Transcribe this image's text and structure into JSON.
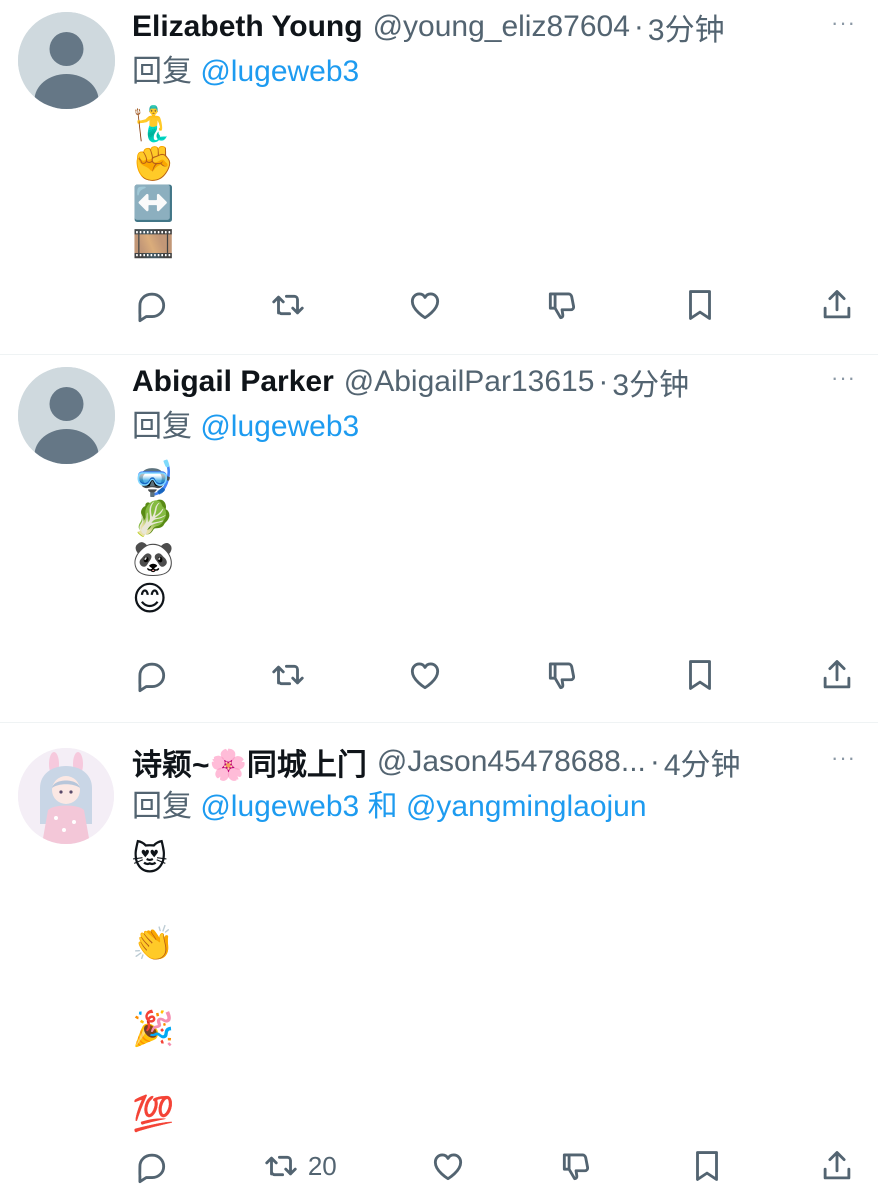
{
  "tweets": [
    {
      "name": "Elizabeth Young",
      "handle": "@young_eliz87604",
      "dot": "·",
      "time": "3分钟",
      "more": "···",
      "reply_prefix": "回复",
      "mentions": [
        "@lugeweb3"
      ],
      "emojis": [
        "🧜‍♂️",
        "✊",
        "↔️",
        "🎞️"
      ],
      "retweet_count": ""
    },
    {
      "name": "Abigail Parker",
      "handle": "@AbigailPar13615",
      "dot": "·",
      "time": "3分钟",
      "more": "···",
      "reply_prefix": "回复",
      "mentions": [
        "@lugeweb3"
      ],
      "emojis": [
        "🤿",
        "🥬",
        "🐼",
        "😊"
      ],
      "retweet_count": ""
    },
    {
      "name": "诗颖~🌸同城上门",
      "handle": "@Jason45478688...",
      "dot": "·",
      "time": "4分钟",
      "more": "···",
      "reply_prefix": "回复",
      "mentions": [
        "@lugeweb3",
        "@yangminglaojun"
      ],
      "conj": "和",
      "emojis": [
        "😻",
        "👏",
        "🎉",
        "💯"
      ],
      "retweet_count": "20"
    }
  ],
  "icons": {
    "reply": "reply-icon",
    "retweet": "retweet-icon",
    "like": "heart-icon",
    "dislike": "thumbs-down-icon",
    "bookmark": "bookmark-icon",
    "share": "share-icon"
  },
  "colors": {
    "link": "#1d9bf0",
    "muted": "#536471",
    "text": "#0f1419",
    "divider": "#eff3f4"
  }
}
